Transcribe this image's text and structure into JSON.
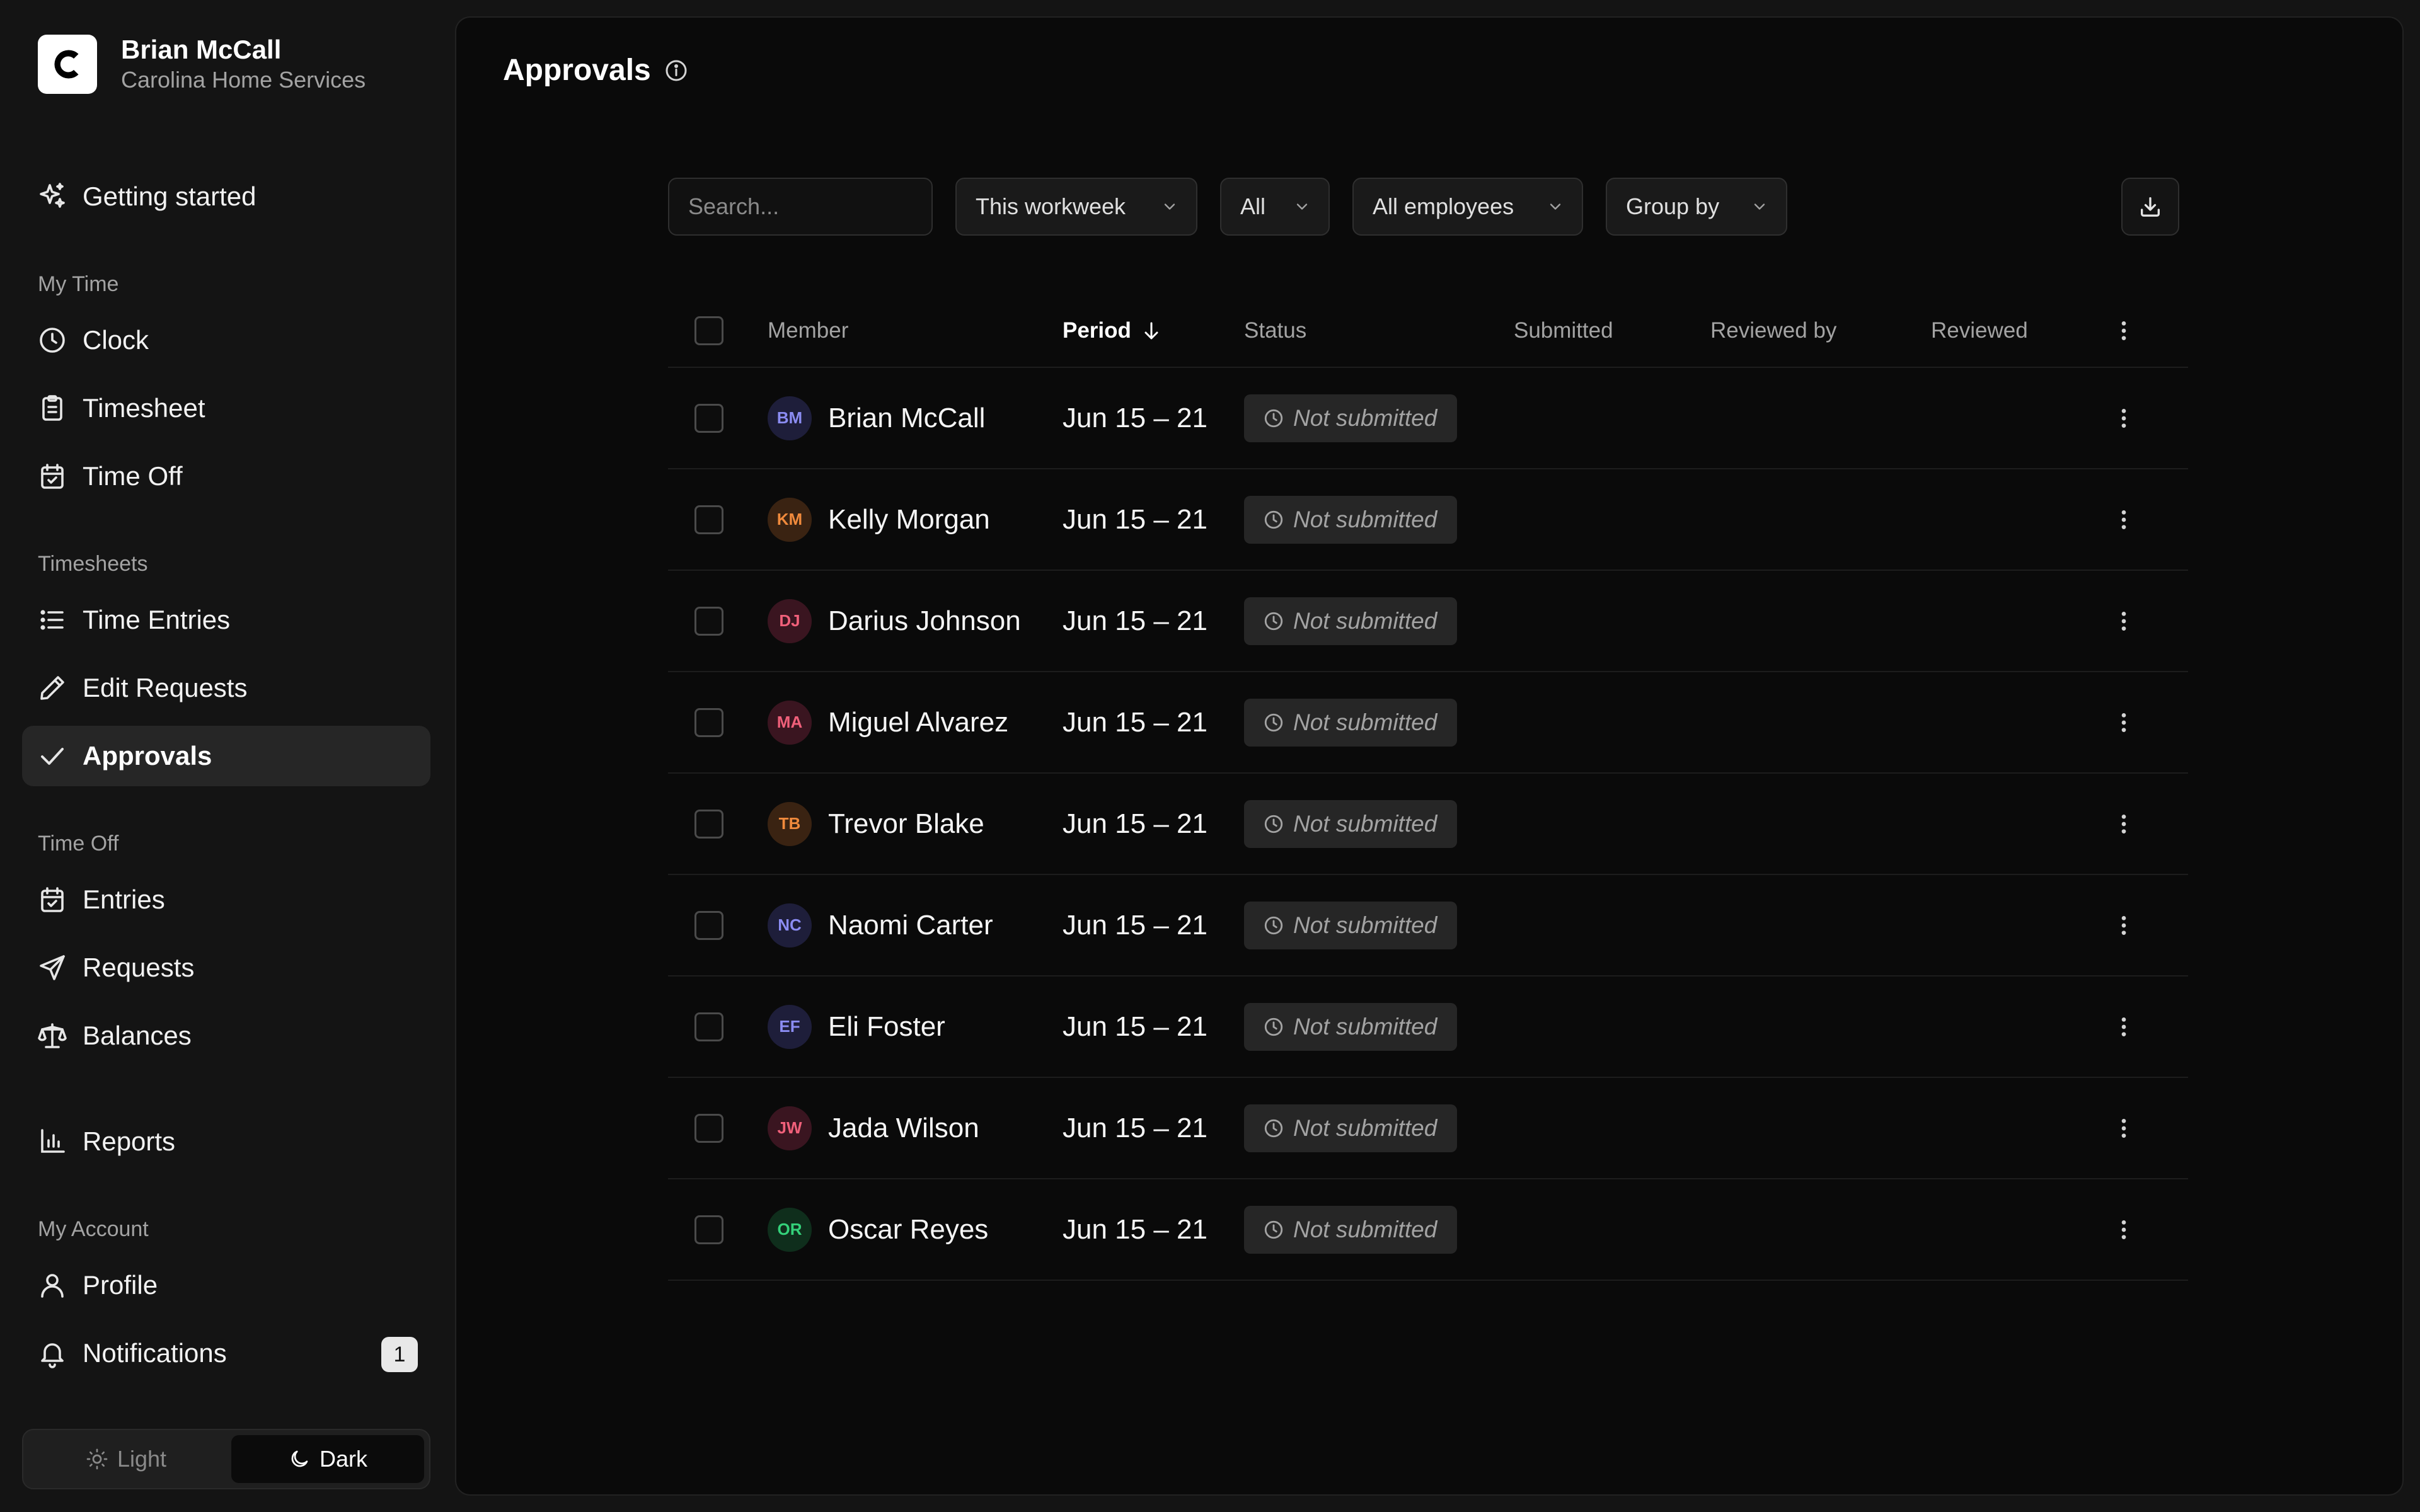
{
  "brand": {
    "logo_letter": "C",
    "user_name": "Brian McCall",
    "org_name": "Carolina Home Services"
  },
  "sidebar": {
    "getting_started": "Getting started",
    "sections": {
      "my_time": "My Time",
      "timesheets": "Timesheets",
      "time_off": "Time Off",
      "my_account": "My Account"
    },
    "items": {
      "clock": "Clock",
      "timesheet": "Timesheet",
      "time_off": "Time Off",
      "time_entries": "Time Entries",
      "edit_requests": "Edit Requests",
      "approvals": "Approvals",
      "entries": "Entries",
      "requests": "Requests",
      "balances": "Balances",
      "reports": "Reports",
      "profile": "Profile",
      "notifications": "Notifications"
    },
    "notifications_count": "1",
    "active_item": "approvals",
    "theme": {
      "light": "Light",
      "dark": "Dark",
      "selected": "dark"
    }
  },
  "page": {
    "title": "Approvals"
  },
  "toolbar": {
    "search_placeholder": "Search...",
    "period_filter": "This workweek",
    "status_filter": "All",
    "employee_filter": "All employees",
    "group_by": "Group by"
  },
  "table": {
    "columns": {
      "member": "Member",
      "period": "Period",
      "status": "Status",
      "submitted": "Submitted",
      "reviewed_by": "Reviewed by",
      "reviewed": "Reviewed"
    },
    "sort": {
      "column": "period",
      "direction": "descending"
    },
    "rows": [
      {
        "initials": "BM",
        "name": "Brian McCall",
        "period": "Jun 15 – 21",
        "status": "Not submitted",
        "avatar_color": "#8b8cf2",
        "avatar_bg": "#1e1e3a"
      },
      {
        "initials": "KM",
        "name": "Kelly Morgan",
        "period": "Jun 15 – 21",
        "status": "Not submitted",
        "avatar_color": "#f08a3c",
        "avatar_bg": "#3a2312"
      },
      {
        "initials": "DJ",
        "name": "Darius Johnson",
        "period": "Jun 15 – 21",
        "status": "Not submitted",
        "avatar_color": "#f0607a",
        "avatar_bg": "#3a1520"
      },
      {
        "initials": "MA",
        "name": "Miguel Alvarez",
        "period": "Jun 15 – 21",
        "status": "Not submitted",
        "avatar_color": "#f0607a",
        "avatar_bg": "#3a1520"
      },
      {
        "initials": "TB",
        "name": "Trevor Blake",
        "period": "Jun 15 – 21",
        "status": "Not submitted",
        "avatar_color": "#f08a3c",
        "avatar_bg": "#3a2312"
      },
      {
        "initials": "NC",
        "name": "Naomi Carter",
        "period": "Jun 15 – 21",
        "status": "Not submitted",
        "avatar_color": "#8b8cf2",
        "avatar_bg": "#1e1e3a"
      },
      {
        "initials": "EF",
        "name": "Eli Foster",
        "period": "Jun 15 – 21",
        "status": "Not submitted",
        "avatar_color": "#8b8cf2",
        "avatar_bg": "#1e1e3a"
      },
      {
        "initials": "JW",
        "name": "Jada Wilson",
        "period": "Jun 15 – 21",
        "status": "Not submitted",
        "avatar_color": "#f0607a",
        "avatar_bg": "#3a1520"
      },
      {
        "initials": "OR",
        "name": "Oscar Reyes",
        "period": "Jun 15 – 21",
        "status": "Not submitted",
        "avatar_color": "#34d17a",
        "avatar_bg": "#0f2e1c"
      }
    ]
  }
}
